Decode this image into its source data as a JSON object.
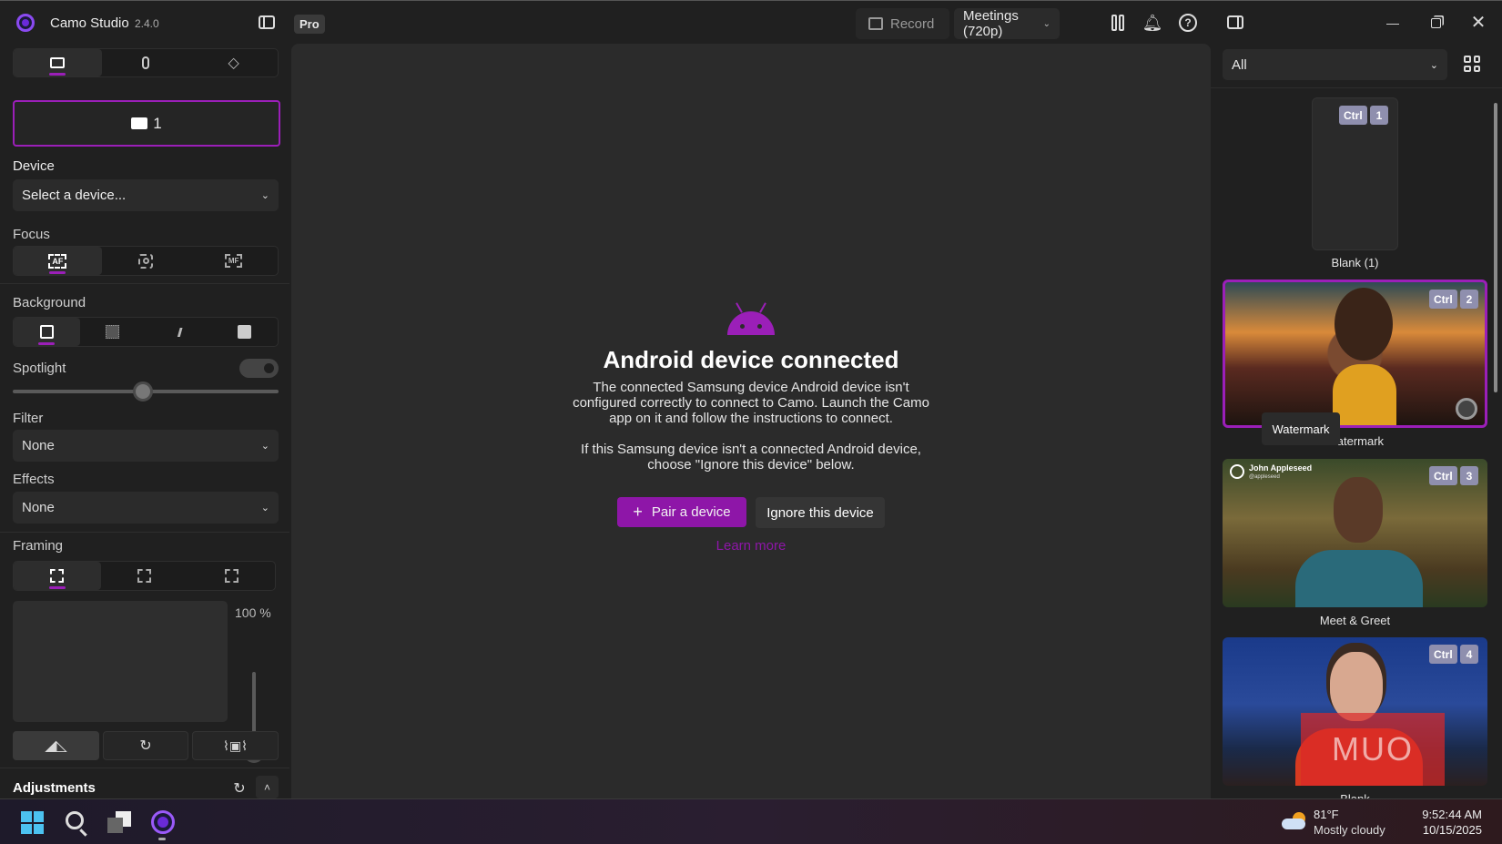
{
  "app": {
    "title": "Camo Studio",
    "version": "2.4.0",
    "badge": "Pro"
  },
  "toolbar": {
    "record": "Record",
    "preset": "Meetings (720p)"
  },
  "left": {
    "camera_label": "1",
    "device": {
      "label": "Device",
      "value": "Select a device..."
    },
    "focus": {
      "label": "Focus",
      "options": [
        "AF",
        "Face",
        "MF"
      ]
    },
    "background": {
      "label": "Background"
    },
    "spotlight": {
      "label": "Spotlight",
      "slider_value": 0.49,
      "enabled": false
    },
    "filter": {
      "label": "Filter",
      "value": "None"
    },
    "effects": {
      "label": "Effects",
      "value": "None"
    },
    "framing": {
      "label": "Framing"
    },
    "zoom": "100 %",
    "adjustments": "Adjustments"
  },
  "center": {
    "title": "Android device connected",
    "message1": "The connected Samsung device Android device isn't configured correctly to connect to Camo. Launch the Camo app on it and follow the instructions to connect.",
    "message2": "If this Samsung device isn't a connected Android device, choose \"Ignore this device\" below.",
    "pair": "Pair a device",
    "ignore": "Ignore this device",
    "learn": "Learn more"
  },
  "right": {
    "filter": "All",
    "ctrl": "Ctrl",
    "scenes": [
      {
        "name": "Blank (1)",
        "key": "1"
      },
      {
        "name": "Watermark",
        "key": "2"
      },
      {
        "name": "Meet & Greet",
        "key": "3",
        "overlay_name": "John Appleseed",
        "overlay_handle": "@appleseed"
      },
      {
        "name": "Blank",
        "key": "4",
        "watermark": "MUO"
      }
    ],
    "tooltip": "Watermark"
  },
  "taskbar": {
    "temp": "81°F",
    "weather": "Mostly cloudy",
    "time": "9:52:44 AM",
    "date": "10/15/2025"
  },
  "colors": {
    "accent": "#8e16a8",
    "bg": "#202020",
    "panel": "#2b2b2b"
  }
}
